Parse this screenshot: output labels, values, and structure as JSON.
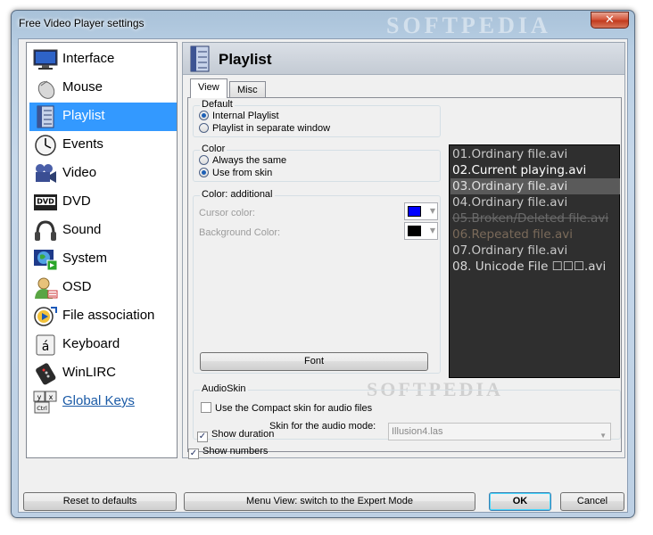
{
  "window": {
    "title": "Free Video Player settings",
    "watermark": "SOFTPEDIA",
    "close_label": "✕"
  },
  "sidebar": {
    "selected_index": 2,
    "items": [
      {
        "label": "Interface",
        "icon": "monitor-icon"
      },
      {
        "label": "Mouse",
        "icon": "mouse-icon"
      },
      {
        "label": "Playlist",
        "icon": "playlist-icon"
      },
      {
        "label": "Events",
        "icon": "clock-icon"
      },
      {
        "label": "Video",
        "icon": "video-camera-icon"
      },
      {
        "label": "DVD",
        "icon": "dvd-icon"
      },
      {
        "label": "Sound",
        "icon": "headphones-icon"
      },
      {
        "label": "System",
        "icon": "system-globe-icon"
      },
      {
        "label": "OSD",
        "icon": "osd-user-icon"
      },
      {
        "label": "File association",
        "icon": "file-association-icon"
      },
      {
        "label": "Keyboard",
        "icon": "keyboard-key-icon"
      },
      {
        "label": "WinLIRC",
        "icon": "remote-control-icon"
      },
      {
        "label": "Global Keys",
        "icon": "global-keys-icon"
      }
    ]
  },
  "panel": {
    "title": "Playlist",
    "tabs": [
      {
        "label": "View",
        "active": true
      },
      {
        "label": "Misc",
        "active": false
      }
    ],
    "default_group": {
      "title": "Default",
      "options": [
        {
          "label": "Internal Playlist",
          "checked": true
        },
        {
          "label": "Playlist in separate window",
          "checked": false
        }
      ]
    },
    "color_group": {
      "title": "Color",
      "options": [
        {
          "label": "Always the same",
          "checked": false
        },
        {
          "label": "Use from skin",
          "checked": true
        }
      ]
    },
    "color_additional": {
      "title": "Color: additional",
      "cursor_label": "Cursor color:",
      "cursor_color": "#0000ff",
      "background_label": "Background Color:",
      "background_color": "#000000",
      "font_button": "Font"
    },
    "preview": {
      "rows": [
        {
          "text": "01.Ordinary file.avi",
          "color": "#c8c8c8",
          "selected": false,
          "strike": false
        },
        {
          "text": "02.Current playing.avi",
          "color": "#ffffff",
          "selected": false,
          "strike": false
        },
        {
          "text": "03.Ordinary file.avi",
          "color": "#e0e0e0",
          "selected": true,
          "strike": false
        },
        {
          "text": "04.Ordinary file.avi",
          "color": "#c8c8c8",
          "selected": false,
          "strike": false
        },
        {
          "text": "05.Broken/Deleted file.avi",
          "color": "#6a6a6a",
          "selected": false,
          "strike": true
        },
        {
          "text": "06.Repeated file.avi",
          "color": "#7a6a5a",
          "selected": false,
          "strike": false
        },
        {
          "text": "07.Ordinary file.avi",
          "color": "#c8c8c8",
          "selected": false,
          "strike": false
        },
        {
          "text": "08. Unicode File ☐☐☐.avi",
          "color": "#d8d8d8",
          "selected": false,
          "strike": false
        }
      ],
      "selected_bg": "#5a5a5a"
    },
    "audioskin": {
      "title": "AudioSkin",
      "compact_label": "Use the Compact skin for audio files",
      "compact_checked": false,
      "skin_label": "Skin for the audio mode:",
      "skin_value": "Illusion4.las"
    },
    "show_numbers": {
      "label": "Show numbers",
      "checked": true
    },
    "show_duration": {
      "label": "Show duration",
      "checked": true
    }
  },
  "footer": {
    "reset_label": "Reset to defaults",
    "menu_view_label": "Menu View: switch to the Expert Mode",
    "ok_label": "OK",
    "cancel_label": "Cancel"
  }
}
